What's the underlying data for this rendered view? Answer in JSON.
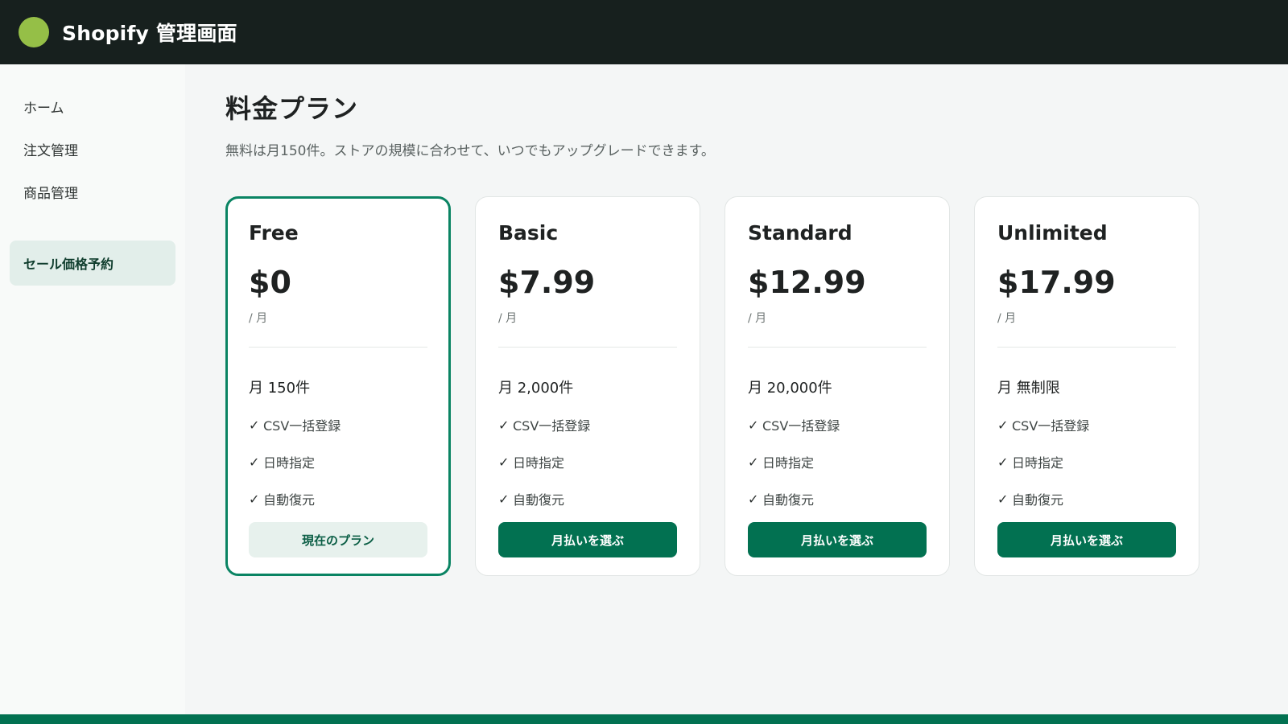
{
  "header": {
    "title": "Shopify 管理画面",
    "logo_color": "#95bf47",
    "background": "#17201e"
  },
  "sidebar": {
    "items": [
      {
        "label": "ホーム",
        "active": false
      },
      {
        "label": "注文管理",
        "active": false
      },
      {
        "label": "商品管理",
        "active": false
      },
      {
        "label": "セール価格予約",
        "active": true
      }
    ]
  },
  "main": {
    "title": "料金プラン",
    "subtitle": "無料は月150件。ストアの規模に合わせて、いつでもアップグレードできます。",
    "plans": [
      {
        "name": "Free",
        "price": "$0",
        "per": "/ 月",
        "quota": "月 150件",
        "features": [
          "CSV一括登録",
          "日時指定",
          "自動復元"
        ],
        "button": "現在のプラン",
        "current": true
      },
      {
        "name": "Basic",
        "price": "$7.99",
        "per": "/ 月",
        "quota": "月 2,000件",
        "features": [
          "CSV一括登録",
          "日時指定",
          "自動復元"
        ],
        "button": "月払いを選ぶ",
        "current": false
      },
      {
        "name": "Standard",
        "price": "$12.99",
        "per": "/ 月",
        "quota": "月 20,000件",
        "features": [
          "CSV一括登録",
          "日時指定",
          "自動復元"
        ],
        "button": "月払いを選ぶ",
        "current": false
      },
      {
        "name": "Unlimited",
        "price": "$17.99",
        "per": "/ 月",
        "quota": "月 無制限",
        "features": [
          "CSV一括登録",
          "日時指定",
          "自動復元"
        ],
        "button": "月払いを選ぶ",
        "current": false
      }
    ]
  },
  "check_glyph": "✓",
  "colors": {
    "accent": "#027151",
    "current_border": "#0a8463",
    "current_button_bg": "#e7f1ed"
  }
}
